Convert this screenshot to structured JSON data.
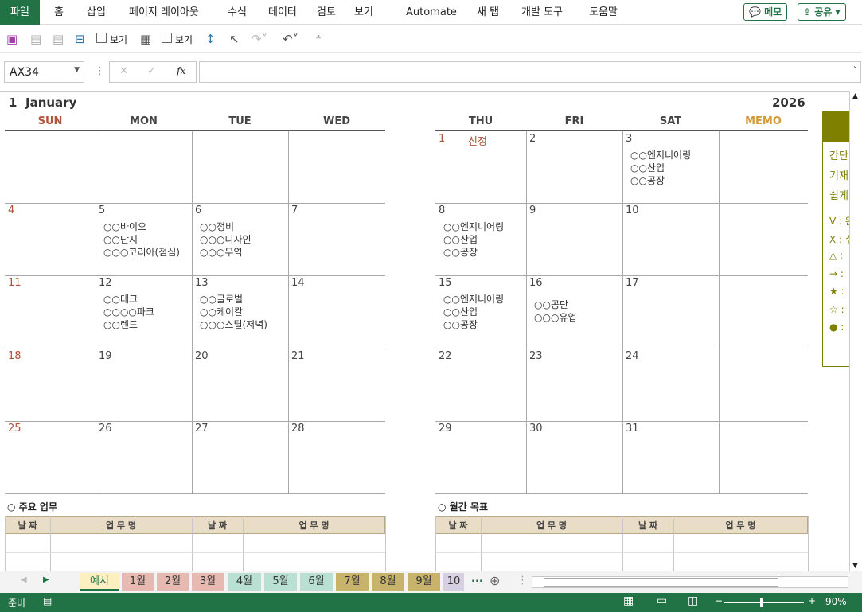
{
  "ribbon": {
    "tabs": [
      "파일",
      "홈",
      "삽입",
      "페이지 레이아웃",
      "수식",
      "데이터",
      "검토",
      "보기",
      "Automate",
      "새 탭",
      "개발 도구",
      "도움말"
    ],
    "memo_btn": "메모",
    "share_btn": "공유"
  },
  "qat": {
    "view1": "보기",
    "view2": "보기"
  },
  "formula": {
    "name_box": "AX34",
    "fx": "fx",
    "value": ""
  },
  "calendar": {
    "month_num": "1",
    "month_name": "January",
    "year": "2026",
    "left_headers": [
      "SUN",
      "MON",
      "TUE",
      "WED"
    ],
    "right_headers": [
      "THU",
      "FRI",
      "SAT",
      "MEMO"
    ],
    "colors": {
      "sun": "#b0533c",
      "memo": "#d49a3a",
      "olive": "#7f7f00"
    },
    "weeks": [
      [
        {
          "d": "",
          "e": ""
        },
        {
          "d": "",
          "e": ""
        },
        {
          "d": "",
          "e": ""
        },
        {
          "d": "",
          "e": ""
        },
        {
          "d": "1",
          "e": "",
          "h": "신정"
        },
        {
          "d": "2",
          "e": ""
        },
        {
          "d": "3",
          "e": "○○엔지니어링\n○○산업\n○○공장"
        }
      ],
      [
        {
          "d": "4",
          "e": ""
        },
        {
          "d": "5",
          "e": "○○바이오\n○○단지\n○○○코리아(점심)"
        },
        {
          "d": "6",
          "e": "○○정비\n○○○디자인\n○○○무역"
        },
        {
          "d": "7",
          "e": ""
        },
        {
          "d": "8",
          "e": "○○엔지니어링\n○○산업\n○○공장"
        },
        {
          "d": "9",
          "e": ""
        },
        {
          "d": "10",
          "e": ""
        }
      ],
      [
        {
          "d": "11",
          "e": ""
        },
        {
          "d": "12",
          "e": "○○테크\n○○○○파크\n○○렌드"
        },
        {
          "d": "13",
          "e": "○○글로벌\n○○케이칼\n○○○스틸(저녁)"
        },
        {
          "d": "14",
          "e": ""
        },
        {
          "d": "15",
          "e": "○○엔지니어링\n○○산업\n○○공장"
        },
        {
          "d": "16",
          "e": "○○공단\n○○○유업"
        },
        {
          "d": "17",
          "e": ""
        }
      ],
      [
        {
          "d": "18",
          "e": ""
        },
        {
          "d": "19",
          "e": ""
        },
        {
          "d": "20",
          "e": ""
        },
        {
          "d": "21",
          "e": ""
        },
        {
          "d": "22",
          "e": ""
        },
        {
          "d": "23",
          "e": ""
        },
        {
          "d": "24",
          "e": ""
        }
      ],
      [
        {
          "d": "25",
          "e": ""
        },
        {
          "d": "26",
          "e": ""
        },
        {
          "d": "27",
          "e": ""
        },
        {
          "d": "28",
          "e": ""
        },
        {
          "d": "29",
          "e": ""
        },
        {
          "d": "30",
          "e": ""
        },
        {
          "d": "31",
          "e": ""
        }
      ]
    ],
    "memo_panel": {
      "lines": [
        "간단",
        "기재",
        "쉽게"
      ],
      "legend": [
        "V : 완",
        "X : 취",
        "△ :",
        "→ :",
        "★ :",
        "☆ :",
        "● :"
      ]
    },
    "tasks_title": "○ 주요 업무",
    "goals_title": "○ 월간 목표",
    "table_headers": [
      "날 짜",
      "업 무 명",
      "날 짜",
      "업 무 명"
    ]
  },
  "sheet_tabs": [
    {
      "label": "예시",
      "color": "#fdf0c0"
    },
    {
      "label": "1월",
      "color": "#e6b9b1"
    },
    {
      "label": "2월",
      "color": "#e6b9b1"
    },
    {
      "label": "3월",
      "color": "#e6b9b1"
    },
    {
      "label": "4월",
      "color": "#b9e0d2"
    },
    {
      "label": "5월",
      "color": "#b9e0d2"
    },
    {
      "label": "6월",
      "color": "#b9e0d2"
    },
    {
      "label": "7월",
      "color": "#c7b36a"
    },
    {
      "label": "8월",
      "color": "#c7b36a"
    },
    {
      "label": "9월",
      "color": "#c7b36a"
    },
    {
      "label": "10",
      "color": "#d5cfe1"
    }
  ],
  "more_tabs": "...",
  "status": {
    "ready": "준비",
    "zoom": "90%"
  }
}
